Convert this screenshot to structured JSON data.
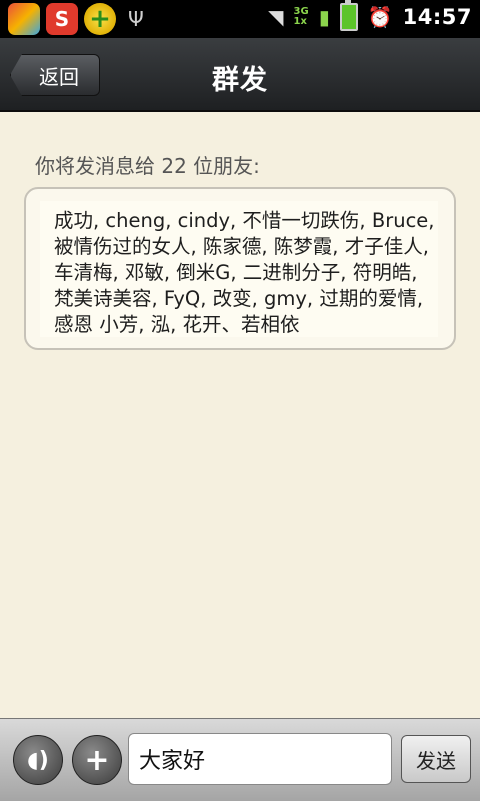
{
  "status_bar": {
    "time": "14:57",
    "network_top": "3G",
    "network_bottom": "1x",
    "app_icon_b_label": "S",
    "app_icon_c_label": "+",
    "usb_glyph": "Ψ",
    "wifi_glyph": "◥",
    "signal_glyph": "▮",
    "alarm_glyph": "⏰"
  },
  "header": {
    "back_label": "返回",
    "title": "群发"
  },
  "main": {
    "prompt_text": "你将发消息给 22 位朋友:",
    "recipients_text": "成功, cheng, cindy, 不惜一切跌伤, Bruce, 被情伤过的女人, 陈家德, 陈梦霞, 才子佳人, 车清梅, 邓敏, 倒米G, 二进制分子, 符明皓, 梵美诗美容, FyQ, 改变, gmy, 过期的爱情, 感恩 小芳, 泓, 花开、若相依"
  },
  "composer": {
    "voice_glyph": "◖)",
    "plus_glyph": "+",
    "message_value": "大家好",
    "send_label": "发送"
  }
}
